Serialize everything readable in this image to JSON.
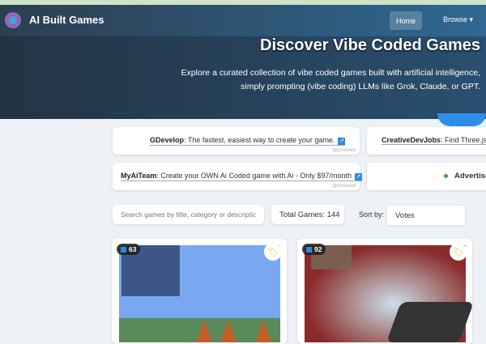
{
  "nav": {
    "brand": "AI Built Games",
    "home": "Home",
    "browse": "Browse ▾"
  },
  "hero": {
    "title": "Discover Vibe Coded Games",
    "line1": "Explore a curated collection of vibe coded games built with artificial intelligence,",
    "line2": "simply prompting (vibe coding) LLMs like Grok, Claude, or GPT."
  },
  "ads": [
    {
      "name": "GDevelop",
      "text": ": The fastest, easiest way to create your game.",
      "sponsored": "Sponsored"
    },
    {
      "name": "CreativeDevJobs",
      "text": ": Find Three.js, "
    },
    {
      "name": "MyAiTeam",
      "text": ": Create your OWN Ai Coded game with Ai - Only $97/month",
      "sponsored": "Sponsored"
    },
    {
      "name": "Advertise",
      "text": ""
    }
  ],
  "controls": {
    "search_placeholder": "Search games by title, category or descriptic",
    "total": "Total Games: 144",
    "sort_label": "Sort by:",
    "sort_value": "Votes"
  },
  "games": [
    {
      "votes": "63"
    },
    {
      "votes": "92"
    }
  ],
  "colors": {
    "accent": "#2a8de0"
  }
}
